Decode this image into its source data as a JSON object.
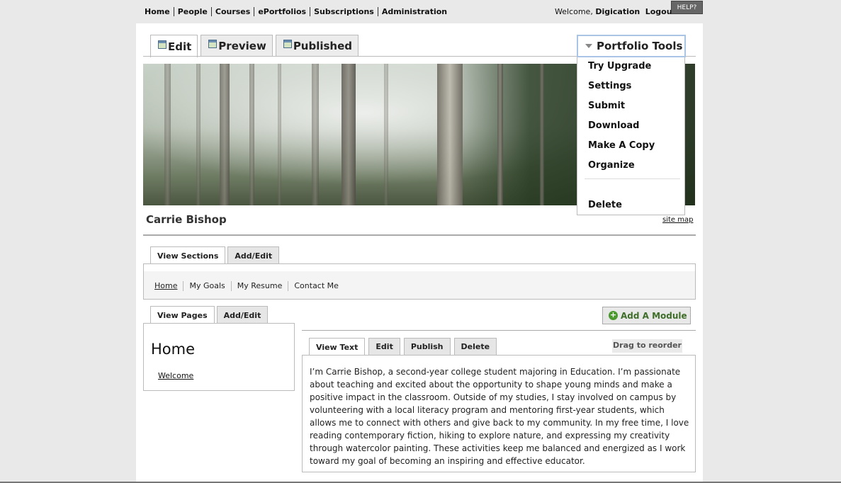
{
  "topnav": {
    "items": [
      "Home",
      "People",
      "Courses",
      "ePortfolios",
      "Subscriptions",
      "Administration"
    ],
    "welcome_text": "Welcome,",
    "user_name": "Digication",
    "logout": "Logout",
    "help": "HELP?"
  },
  "mode_tabs": {
    "edit": "Edit",
    "preview": "Preview",
    "published": "Published"
  },
  "tools": {
    "label": "Portfolio Tools",
    "items": [
      "Try Upgrade",
      "Settings",
      "Submit",
      "Download",
      "Make A Copy",
      "Organize"
    ],
    "delete": "Delete"
  },
  "portfolio": {
    "owner": "Carrie Bishop",
    "site_map": "site map"
  },
  "sections": {
    "tabs": [
      "View Sections",
      "Add/Edit"
    ],
    "links": [
      "Home",
      "My Goals",
      "My Resume",
      "Contact Me"
    ]
  },
  "pages": {
    "tabs": [
      "View Pages",
      "Add/Edit"
    ],
    "title": "Home",
    "link": "Welcome"
  },
  "module": {
    "add_button": "Add A Module",
    "tabs": [
      "View Text",
      "Edit",
      "Publish",
      "Delete"
    ],
    "drag": "Drag to reorder",
    "text": "I’m Carrie Bishop, a second-year college student majoring in Education. I’m passionate about teaching and excited about the opportunity to shape young minds and make a positive impact in the classroom. Outside of my studies, I stay involved on campus by volunteering with a local literacy program and mentoring first-year students, which allows me to connect with others and give back to my community. In my free time, I love reading contemporary fiction, hiking to explore nature, and expressing my creativity through watercolor painting. These activities keep me balanced and energized as I work toward my goal of becoming an inspiring and effective educator."
  },
  "colors": {
    "accent_green": "#4c9a2f",
    "tools_border": "#a9c4e4",
    "help_bg": "#666666"
  }
}
